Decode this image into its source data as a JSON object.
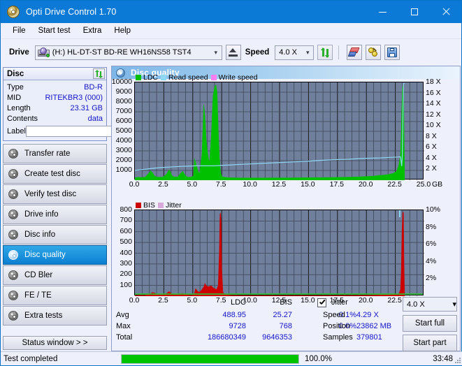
{
  "window": {
    "title": "Opti Drive Control 1.70",
    "icon": "disc-icon",
    "minimize": "–",
    "maximize": "☐",
    "close": "✕"
  },
  "menu": [
    "File",
    "Start test",
    "Extra",
    "Help"
  ],
  "toolbar": {
    "drive_label": "Drive",
    "drive_value": "(H:)   HL-DT-ST BD-RE  WH16NS58 TST4",
    "eject_icon": "eject-icon",
    "speed_label": "Speed",
    "speed_value": "4.0 X",
    "refresh_icon": "refresh-icon",
    "erase_icon": "eraser-icon",
    "bell_icon": "bell-icon",
    "save_icon": "save-icon"
  },
  "disc_panel": {
    "title": "Disc",
    "refresh_icon": "refresh-icon",
    "rows": [
      {
        "key": "Type",
        "value": "BD-R"
      },
      {
        "key": "MID",
        "value": "RITEKBR3 (000)"
      },
      {
        "key": "Length",
        "value": "23.31 GB"
      },
      {
        "key": "Contents",
        "value": "data"
      }
    ],
    "label_key": "Label",
    "label_value": "",
    "label_placeholder": "",
    "cd_icon": "disc-icon"
  },
  "sidebar": {
    "items": [
      {
        "label": "Transfer rate",
        "active": false
      },
      {
        "label": "Create test disc",
        "active": false
      },
      {
        "label": "Verify test disc",
        "active": false
      },
      {
        "label": "Drive info",
        "active": false
      },
      {
        "label": "Disc info",
        "active": false
      },
      {
        "label": "Disc quality",
        "active": true
      },
      {
        "label": "CD Bler",
        "active": false
      },
      {
        "label": "FE / TE",
        "active": false
      },
      {
        "label": "Extra tests",
        "active": false
      }
    ],
    "status_window_button": "Status window > >"
  },
  "main": {
    "header": "Disc quality",
    "header_icon": "disc-icon"
  },
  "stats": {
    "col_ldc": "LDC",
    "col_bis": "BIS",
    "rows": [
      {
        "key": "Avg",
        "ldc": "488.95",
        "bis": "25.27",
        "jitter": "-0.1%"
      },
      {
        "key": "Max",
        "ldc": "9728",
        "bis": "768",
        "jitter": "0.0%"
      },
      {
        "key": "Total",
        "ldc": "186680349",
        "bis": "9646353",
        "jitter": ""
      }
    ],
    "jitter_label": "Jitter",
    "jitter_checked": true,
    "speed_key": "Speed",
    "speed_value": "4.29 X",
    "position_key": "Position",
    "position_value": "23862 MB",
    "samples_key": "Samples",
    "samples_value": "379801",
    "speed_select": "4.0 X",
    "start_full": "Start full",
    "start_part": "Start part"
  },
  "statusbar": {
    "text": "Test completed",
    "percent_label": "100.0%",
    "percent_value": 100,
    "time": "33:48"
  },
  "colors": {
    "accent": "#0b7ad6",
    "value_text": "#1414c8",
    "ldc_green": "#00c000",
    "bis_red": "#cc0000",
    "read_speed": "#8fd8f5",
    "write_speed": "#ff7ff0",
    "jitter": "#d8a8d8",
    "plot_bg": "#6f7f9c",
    "progress": "#00c400"
  },
  "chart_data": [
    {
      "type": "area",
      "name": "ldc-chart",
      "title": "",
      "xlabel": "GB",
      "ylabel": "",
      "xlim": [
        0,
        25
      ],
      "ylim": [
        0,
        10000
      ],
      "y2lim": [
        0,
        18
      ],
      "grid": true,
      "legend_position": "top-left",
      "legend": [
        "LDC",
        "Read speed",
        "Write speed"
      ],
      "xticks": [
        "0.0",
        "2.5",
        "5.0",
        "7.5",
        "10.0",
        "12.5",
        "15.0",
        "17.5",
        "20.0",
        "22.5",
        "25.0"
      ],
      "xunit": "GB",
      "yticks": [
        1000,
        2000,
        3000,
        4000,
        5000,
        6000,
        7000,
        8000,
        9000,
        10000
      ],
      "y2ticks": [
        "2 X",
        "4 X",
        "6 X",
        "8 X",
        "10 X",
        "12 X",
        "14 X",
        "16 X",
        "18 X"
      ],
      "series": [
        {
          "name": "LDC",
          "color": "#00c000",
          "x": [
            0.0,
            0.3,
            0.6,
            0.9,
            1.2,
            1.35,
            1.5,
            1.7,
            1.9,
            2.1,
            2.4,
            2.7,
            2.95,
            3.05,
            3.2,
            3.4,
            3.7,
            4.0,
            4.15,
            4.3,
            4.5,
            4.8,
            5.05,
            5.15,
            5.3,
            5.45,
            5.6,
            5.8,
            5.95,
            6.05,
            6.15,
            6.3,
            6.45,
            6.6,
            6.75,
            6.9,
            7.0,
            7.1,
            7.2,
            7.3,
            7.4,
            7.5,
            7.6,
            7.75,
            7.9,
            8.1,
            8.4,
            8.8,
            9.3,
            10.0,
            11.0,
            12.0,
            13.0,
            14.0,
            15.0,
            16.0,
            17.0,
            18.0,
            19.0,
            20.0,
            20.6,
            21.0,
            21.5,
            22.0,
            22.3,
            22.6,
            22.8,
            22.95,
            23.02,
            23.08,
            23.12,
            23.16,
            23.2,
            23.25,
            23.3
          ],
          "y": [
            250,
            300,
            280,
            320,
            700,
            950,
            800,
            420,
            330,
            300,
            320,
            560,
            1050,
            900,
            450,
            330,
            340,
            780,
            900,
            560,
            330,
            300,
            420,
            2200,
            1600,
            900,
            700,
            2700,
            7700,
            6500,
            4300,
            2600,
            1700,
            4500,
            8600,
            9600,
            9728,
            9000,
            5200,
            2300,
            900,
            420,
            330,
            300,
            280,
            260,
            250,
            240,
            230,
            230,
            230,
            235,
            240,
            250,
            255,
            260,
            280,
            300,
            330,
            380,
            420,
            480,
            520,
            600,
            700,
            900,
            1500,
            2600,
            5000,
            8000,
            9400,
            9700,
            9728,
            5000,
            300
          ]
        },
        {
          "name": "Read speed",
          "color": "#8fd8f5",
          "axis": "right",
          "x": [
            0.0,
            0.8,
            1.6,
            2.4,
            3.2,
            4.0,
            4.8,
            5.3,
            5.6,
            6.2,
            6.9,
            7.3,
            7.6,
            8.2,
            9.0,
            10.0,
            11.0,
            12.0,
            13.0,
            14.0,
            15.0,
            15.6,
            16.5,
            17.5,
            18.4,
            19.2,
            20.2,
            21.2,
            22.0,
            22.6,
            22.95,
            23.05,
            23.1,
            23.2,
            23.3
          ],
          "y": [
            1.8,
            2.0,
            2.2,
            2.35,
            2.45,
            2.55,
            2.6,
            2.65,
            2.65,
            2.65,
            2.65,
            2.7,
            2.75,
            2.8,
            2.9,
            3.0,
            3.1,
            3.2,
            3.3,
            3.4,
            3.5,
            3.6,
            3.7,
            3.8,
            3.85,
            3.95,
            4.05,
            4.1,
            4.2,
            4.25,
            4.3,
            2.6,
            4.3,
            17.8,
            17.8
          ]
        },
        {
          "name": "Write speed",
          "color": "#ff7ff0",
          "x": [],
          "y": []
        }
      ]
    },
    {
      "type": "area",
      "name": "bis-chart",
      "title": "",
      "xlabel": "GB",
      "ylabel": "",
      "xlim": [
        0,
        25
      ],
      "ylim": [
        0,
        800
      ],
      "y2lim": [
        0,
        10
      ],
      "grid": true,
      "legend_position": "top-left",
      "legend": [
        "BIS",
        "Jitter"
      ],
      "xticks": [
        "0.0",
        "2.5",
        "5.0",
        "7.5",
        "10.0",
        "12.5",
        "15.0",
        "17.5",
        "20.0",
        "22.5",
        "25.0"
      ],
      "xunit": "GB",
      "yticks": [
        100,
        200,
        300,
        400,
        500,
        600,
        700,
        800
      ],
      "y2ticks": [
        "2%",
        "4%",
        "6%",
        "8%",
        "10%"
      ],
      "series": [
        {
          "name": "BIS",
          "color": "#cc0000",
          "x": [
            0.0,
            0.4,
            0.9,
            1.3,
            1.5,
            1.7,
            1.9,
            2.2,
            2.6,
            2.95,
            3.1,
            3.3,
            3.6,
            3.9,
            4.1,
            4.3,
            4.6,
            4.9,
            5.1,
            5.25,
            5.4,
            5.5,
            5.65,
            5.8,
            5.95,
            6.05,
            6.15,
            6.3,
            6.45,
            6.6,
            6.75,
            6.9,
            7.05,
            7.2,
            7.3,
            7.35,
            7.4,
            7.45,
            7.5,
            7.6,
            7.7,
            7.85,
            8.0,
            8.3,
            9.0,
            10.0,
            12.0,
            14.0,
            16.0,
            18.0,
            19.5,
            20.5,
            21.5,
            22.3,
            22.8,
            22.95,
            23.02,
            23.08,
            23.14,
            23.2,
            23.25,
            23.3
          ],
          "y": [
            6,
            8,
            9,
            18,
            34,
            30,
            16,
            10,
            14,
            42,
            30,
            14,
            12,
            20,
            26,
            18,
            10,
            8,
            14,
            70,
            48,
            36,
            42,
            62,
            85,
            118,
            100,
            88,
            92,
            96,
            78,
            70,
            60,
            100,
            420,
            760,
            775,
            700,
            260,
            40,
            22,
            14,
            10,
            8,
            6,
            5,
            5,
            5,
            5,
            6,
            7,
            9,
            11,
            14,
            20,
            60,
            250,
            620,
            775,
            780,
            300,
            8
          ]
        },
        {
          "name": "Jitter",
          "color": "#d8a8d8",
          "axis": "right",
          "x": [],
          "y": []
        }
      ]
    }
  ]
}
